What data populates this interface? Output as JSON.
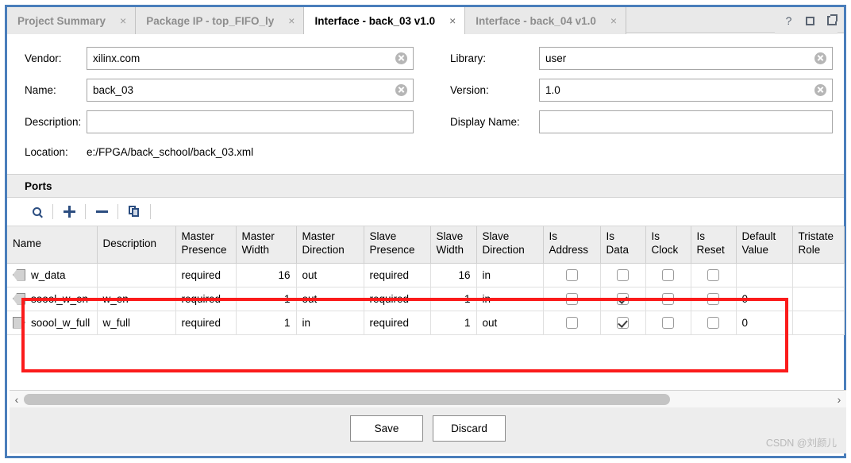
{
  "window": {
    "controls": [
      {
        "name": "help-icon",
        "glyph": "?"
      },
      {
        "name": "maximize-icon",
        "glyph": ""
      },
      {
        "name": "detach-icon",
        "glyph": ""
      }
    ]
  },
  "tabs": [
    {
      "label": "Project Summary",
      "close": "×",
      "active": false
    },
    {
      "label": "Package IP - top_FIFO_ly",
      "close": "×",
      "active": false
    },
    {
      "label": "Interface - back_03 v1.0",
      "close": "×",
      "active": true
    },
    {
      "label": "Interface - back_04 v1.0",
      "close": "×",
      "active": false
    }
  ],
  "form": {
    "vendor_label": "Vendor:",
    "vendor_value": "xilinx.com",
    "name_label": "Name:",
    "name_value": "back_03",
    "description_label": "Description:",
    "description_value": "",
    "library_label": "Library:",
    "library_value": "user",
    "version_label": "Version:",
    "version_value": "1.0",
    "display_name_label": "Display Name:",
    "display_name_value": "",
    "location_label": "Location:",
    "location_value": "e:/FPGA/back_school/back_03.xml"
  },
  "ports": {
    "section_title": "Ports",
    "toolbar": [
      {
        "name": "search-icon",
        "tooltip": "Search"
      },
      {
        "name": "add-icon",
        "tooltip": "Add"
      },
      {
        "name": "remove-icon",
        "tooltip": "Remove"
      },
      {
        "name": "copy-icon",
        "tooltip": "Copy"
      }
    ],
    "columns": [
      {
        "label": "Name",
        "line2": ""
      },
      {
        "label": "Description",
        "line2": ""
      },
      {
        "label": "Master",
        "line2": "Presence"
      },
      {
        "label": "Master",
        "line2": "Width"
      },
      {
        "label": "Master",
        "line2": "Direction"
      },
      {
        "label": "Slave",
        "line2": "Presence"
      },
      {
        "label": "Slave",
        "line2": "Width"
      },
      {
        "label": "Slave",
        "line2": "Direction"
      },
      {
        "label": "Is",
        "line2": "Address"
      },
      {
        "label": "Is",
        "line2": "Data"
      },
      {
        "label": "Is",
        "line2": "Clock"
      },
      {
        "label": "Is",
        "line2": "Reset"
      },
      {
        "label": "Default",
        "line2": "Value"
      },
      {
        "label": "Tristate",
        "line2": "Role"
      }
    ],
    "rows": [
      {
        "port_direction_icon": "in",
        "name": "w_data",
        "description": "",
        "master_presence": "required",
        "master_width": "16",
        "master_direction": "out",
        "slave_presence": "required",
        "slave_width": "16",
        "slave_direction": "in",
        "is_address": false,
        "is_data": false,
        "is_clock": false,
        "is_reset": false,
        "default_value": "",
        "tristate_role": ""
      },
      {
        "port_direction_icon": "in",
        "name": "soool_w_en",
        "description": "w_en",
        "master_presence": "required",
        "master_width": "1",
        "master_direction": "out",
        "slave_presence": "required",
        "slave_width": "1",
        "slave_direction": "in",
        "is_address": false,
        "is_data": true,
        "is_clock": false,
        "is_reset": false,
        "default_value": "0",
        "tristate_role": ""
      },
      {
        "port_direction_icon": "out",
        "name": "soool_w_full",
        "description": "w_full",
        "master_presence": "required",
        "master_width": "1",
        "master_direction": "in",
        "slave_presence": "required",
        "slave_width": "1",
        "slave_direction": "out",
        "is_address": false,
        "is_data": true,
        "is_clock": false,
        "is_reset": false,
        "default_value": "0",
        "tristate_role": ""
      }
    ]
  },
  "scrollbar": {
    "left_arrow": "‹",
    "right_arrow": "›",
    "thumb_percent": 80
  },
  "footer": {
    "save_label": "Save",
    "discard_label": "Discard",
    "watermark": "CSDN @刘颜儿"
  },
  "colors": {
    "frame_blue": "#4a7ebb",
    "annotation_red": "#fb1b1b",
    "toolbar_icon": "#2b4d80",
    "header_gray": "#ededed"
  }
}
